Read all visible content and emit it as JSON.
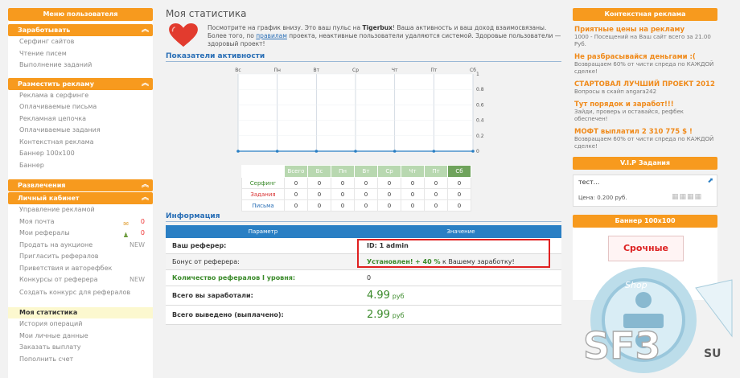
{
  "left_menu": {
    "header": "Меню пользователя",
    "sections": [
      {
        "title": "Заработывать",
        "items": [
          "Серфинг сайтов",
          "Чтение писем",
          "Выполнение заданий"
        ]
      },
      {
        "title": "Разместить рекламу",
        "items": [
          "Реклама в серфинге",
          "Оплачиваемые письма",
          "Рекламная цепочка",
          "Оплачиваемые задания",
          "Контекстная реклама",
          "Баннер 100x100",
          "Баннер"
        ]
      },
      {
        "title": "Развлечения",
        "items": []
      },
      {
        "title": "Личный кабинет",
        "items": [
          "Управление рекламой",
          "Моя почта",
          "Мои рефералы",
          "Продать на аукционе",
          "Пригласить рефералов",
          "Приветствия и авторефбек",
          "Конкурсы от реферера",
          "Создать конкурс для рефералов",
          "Моя статистика",
          "История операций",
          "Мои личные данные",
          "Заказать выплату",
          "Пополнить счет"
        ]
      }
    ],
    "badges": {
      "mail": "0",
      "referrals": "0",
      "auction": "NEW",
      "contests": "NEW"
    }
  },
  "main": {
    "title": "Моя статистика",
    "intro_p1": "Посмотрите на график внизу. Это ваш пульс на ",
    "intro_brand": "Tigerbux",
    "intro_p2": "! Ваша активность и ваш доход взаимосвязаны. Более того, по ",
    "intro_link": "правилам",
    "intro_p3": " проекта, неактивные пользователи удаляются системой. Здоровые пользователи — здоровый проект!",
    "activity_title": "Показатели активности",
    "info_title": "Информация",
    "stats_table": {
      "days": [
        "Вс",
        "Пн",
        "Вт",
        "Ср",
        "Чт",
        "Пт",
        "Сб"
      ],
      "total_label": "Всего",
      "rows": [
        {
          "label": "Серфинг",
          "color": "#3a8a2a",
          "values": [
            "0",
            "0",
            "0",
            "0",
            "0",
            "0",
            "0",
            "0"
          ]
        },
        {
          "label": "Задания",
          "color": "#d83030",
          "values": [
            "0",
            "0",
            "0",
            "0",
            "0",
            "0",
            "0",
            "0"
          ]
        },
        {
          "label": "Письма",
          "color": "#2a6fb6",
          "values": [
            "0",
            "0",
            "0",
            "0",
            "0",
            "0",
            "0",
            "0"
          ]
        }
      ]
    },
    "info_table": {
      "col_param": "Параметр",
      "col_value": "Значение",
      "referrer_label": "Ваш реферер:",
      "referrer_value": "ID: 1 admin",
      "bonus_label": "Бонус от реферера:",
      "bonus_prefix": "Установлен!",
      "bonus_percent": "+ 40 %",
      "bonus_suffix": "к Вашему заработку!",
      "ref_count_label": "Количество рефералов I уровня:",
      "ref_count_value": "0",
      "earned_label": "Всего вы заработали:",
      "earned_amount": "4.99",
      "earned_unit": "руб",
      "paid_label": "Всего выведено (выплачено):",
      "paid_amount": "2.99",
      "paid_unit": "руб"
    }
  },
  "chart_data": {
    "type": "line",
    "categories": [
      "Вс",
      "Пн",
      "Вт",
      "Ср",
      "Чт",
      "Пт",
      "Сб"
    ],
    "series": [
      {
        "values": [
          0,
          0,
          0,
          0,
          0,
          0,
          0
        ]
      }
    ],
    "yticks": [
      "1",
      "0.8",
      "0.6",
      "0.4",
      "0.2",
      "0"
    ],
    "ylim": [
      0,
      1
    ],
    "grid": true,
    "line_color": "#2a7fc4"
  },
  "right": {
    "context_header": "Контекстная реклама",
    "ads": [
      {
        "title": "Приятные цены на рекламу",
        "desc": "1000 - Посещений на Ваш сайт всего за 21.00 Руб."
      },
      {
        "title": "Не разбрасывайся деньгами :(",
        "desc": "Возвращаем 60% от чисти спреда по КАЖДОЙ сделке!"
      },
      {
        "title": "СТАРТОВАЛ ЛУЧШИЙ ПРОЕКТ 2012",
        "desc": "Вопросы в скайп angara242"
      },
      {
        "title": "Тут порядок и заработ!!!",
        "desc": "Зайди, проверь и оставайся, рефбек обеспечен!"
      },
      {
        "title": "МОФТ выплатил 2 310 775 $ !",
        "desc": "Возвращаем 60% от чисти спреда по КАЖДОЙ сделке!"
      }
    ],
    "vip_header": "V.I.P Задания",
    "vip_task": "тест...",
    "vip_price": "Цена: 0.200 руб.",
    "banner_header": "Баннер 100x100",
    "banner_text": "Срочные"
  },
  "watermark": {
    "brand": "SF3",
    "tld": "SU",
    "ring_text": "Shop"
  },
  "colors": {
    "orange": "#f79a1e",
    "blue": "#2a7fc4",
    "green": "#3a8a2a",
    "red": "#e02020"
  }
}
